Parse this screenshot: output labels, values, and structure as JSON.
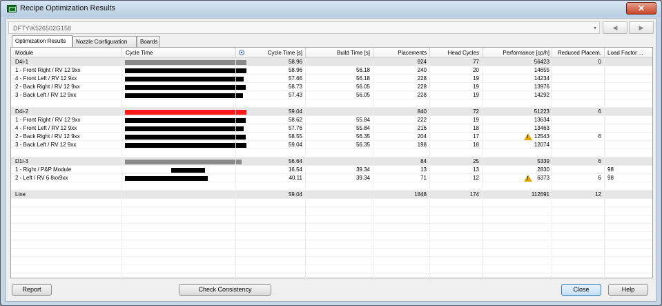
{
  "window": {
    "title": "Recipe Optimization Results",
    "close_glyph": "✕"
  },
  "path": {
    "value": "DFTY\\K526502G158",
    "dropdown_glyph": "▾"
  },
  "nav": {
    "prev_glyph": "◀",
    "next_glyph": "▶"
  },
  "tabs": [
    "Optimization Results",
    "Nozzle Configuration",
    "Boards"
  ],
  "columns": {
    "module": "Module",
    "cycle_time_bar": "Cycle Time",
    "cycle_time": "Cycle Time [s]",
    "build_time": "Build Time [s]",
    "placements": "Placements",
    "head_cycles": "Head Cycles",
    "performance": "Performance [cp/h]",
    "reduced": "Reduced Placem.",
    "load_factor": "Load Factor ..."
  },
  "bar_scale_max_s": 59.04,
  "rows": [
    {
      "type": "group",
      "module": "D4i-1",
      "bar": 58.96,
      "bar_color": "gray",
      "cycle": "58.96",
      "build": "",
      "placements": "924",
      "head": "77",
      "perf": "56423",
      "reduced": "0",
      "warn": false,
      "load": ""
    },
    {
      "type": "item",
      "module": "1 - Front Right / RV 12 9xx",
      "bar": 58.96,
      "bar_color": "black",
      "cycle": "58.96",
      "build": "56.18",
      "placements": "240",
      "head": "20",
      "perf": "14655",
      "reduced": "",
      "warn": false,
      "load": ""
    },
    {
      "type": "item",
      "module": "4 - Front Left / RV 12 9xx",
      "bar": 57.66,
      "bar_color": "black",
      "cycle": "57.66",
      "build": "56.18",
      "placements": "228",
      "head": "19",
      "perf": "14234",
      "reduced": "",
      "warn": false,
      "load": ""
    },
    {
      "type": "item",
      "module": "2 - Back Right / RV 12 9xx",
      "bar": 58.73,
      "bar_color": "black",
      "cycle": "58.73",
      "build": "56.05",
      "placements": "228",
      "head": "19",
      "perf": "13976",
      "reduced": "",
      "warn": false,
      "load": ""
    },
    {
      "type": "item",
      "module": "3 - Back Left / RV 12 9xx",
      "bar": 57.43,
      "bar_color": "black",
      "cycle": "57.43",
      "build": "56.05",
      "placements": "228",
      "head": "19",
      "perf": "14292",
      "reduced": "",
      "warn": false,
      "load": ""
    },
    {
      "type": "blank"
    },
    {
      "type": "group",
      "module": "D4i-2",
      "bar": 59.04,
      "bar_color": "red",
      "cycle": "59.04",
      "build": "",
      "placements": "840",
      "head": "72",
      "perf": "51223",
      "reduced": "6",
      "warn": false,
      "load": ""
    },
    {
      "type": "item",
      "module": "1 - Front Right / RV 12 9xx",
      "bar": 58.62,
      "bar_color": "black",
      "cycle": "58.62",
      "build": "55.84",
      "placements": "222",
      "head": "19",
      "perf": "13634",
      "reduced": "",
      "warn": false,
      "load": ""
    },
    {
      "type": "item",
      "module": "4 - Front Left / RV 12 9xx",
      "bar": 57.76,
      "bar_color": "black",
      "cycle": "57.76",
      "build": "55.84",
      "placements": "216",
      "head": "18",
      "perf": "13463",
      "reduced": "",
      "warn": false,
      "load": ""
    },
    {
      "type": "item",
      "module": "2 - Back Right / RV 12 9xx",
      "bar": 58.55,
      "bar_color": "black",
      "cycle": "58.55",
      "build": "56.35",
      "placements": "204",
      "head": "17",
      "perf": "12543",
      "reduced": "6",
      "warn": true,
      "load": ""
    },
    {
      "type": "item",
      "module": "3 - Back Left / RV 12 9xx",
      "bar": 59.04,
      "bar_color": "black",
      "cycle": "59.04",
      "build": "56.35",
      "placements": "198",
      "head": "18",
      "perf": "12074",
      "reduced": "",
      "warn": false,
      "load": ""
    },
    {
      "type": "blank"
    },
    {
      "type": "group",
      "module": "D1i-3",
      "bar": 56.64,
      "bar_color": "gray",
      "cycle": "56.64",
      "build": "",
      "placements": "84",
      "head": "25",
      "perf": "5339",
      "reduced": "6",
      "warn": false,
      "load": ""
    },
    {
      "type": "item",
      "module": "1 - Right / P&P Module",
      "bar": 16.54,
      "bar_offset": 40.11,
      "bar_color": "black",
      "cycle": "16.54",
      "build": "39.34",
      "placements": "13",
      "head": "13",
      "perf": "2830",
      "reduced": "",
      "warn": false,
      "load": "98"
    },
    {
      "type": "item",
      "module": "2 - Left / RV 6 8xx9xx",
      "bar": 40.11,
      "bar_color": "black",
      "cycle": "40.11",
      "build": "39.34",
      "placements": "71",
      "head": "12",
      "perf": "6373",
      "reduced": "6",
      "warn": true,
      "load": "98"
    },
    {
      "type": "blank"
    },
    {
      "type": "group",
      "module": "Line",
      "bar": 0,
      "bar_color": "none",
      "cycle": "59.04",
      "build": "",
      "placements": "1848",
      "head": "174",
      "perf": "112691",
      "reduced": "12",
      "warn": false,
      "load": ""
    }
  ],
  "buttons": {
    "report": "Report",
    "check": "Check Consistency",
    "close": "Close",
    "help": "Help"
  }
}
